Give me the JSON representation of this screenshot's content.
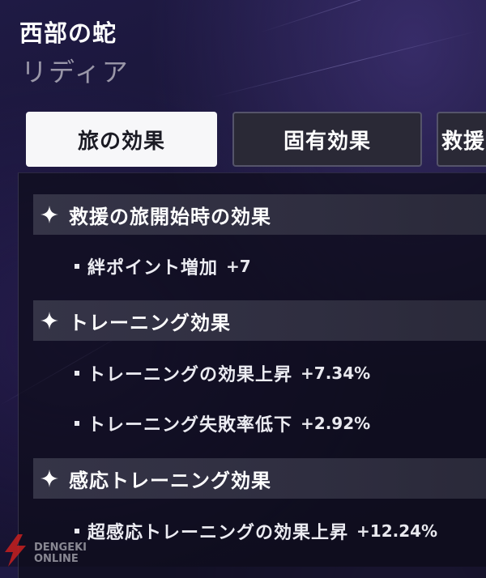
{
  "character": {
    "name": "西部の蛇",
    "subname": "リディア"
  },
  "tabs": [
    {
      "label": "旅の効果",
      "active": true
    },
    {
      "label": "固有効果",
      "active": false
    },
    {
      "label": "救援",
      "active": false
    }
  ],
  "sections": [
    {
      "title": "救援の旅開始時の効果",
      "icon": "sparkle-icon",
      "effects": [
        {
          "label": "絆ポイント増加",
          "value": "+7"
        }
      ]
    },
    {
      "title": "トレーニング効果",
      "icon": "sparkle-icon",
      "effects": [
        {
          "label": "トレーニングの効果上昇",
          "value": "+7.34%"
        },
        {
          "label": "トレーニング失敗率低下",
          "value": "+2.92%"
        }
      ]
    },
    {
      "title": "感応トレーニング効果",
      "icon": "sparkle-icon",
      "effects": [
        {
          "label": "超感応トレーニングの効果上昇",
          "value": "+12.24%"
        }
      ]
    }
  ],
  "watermark": {
    "line1": "DENGEKI",
    "line2": "ONLINE"
  },
  "colors": {
    "background": "#171433",
    "active_tab_bg": "#f7f7f9",
    "inactive_tab_bg": "#2a2936",
    "section_header_bg": "#353447",
    "subname_text": "#9a97a8",
    "watermark_red": "#c8201e"
  }
}
